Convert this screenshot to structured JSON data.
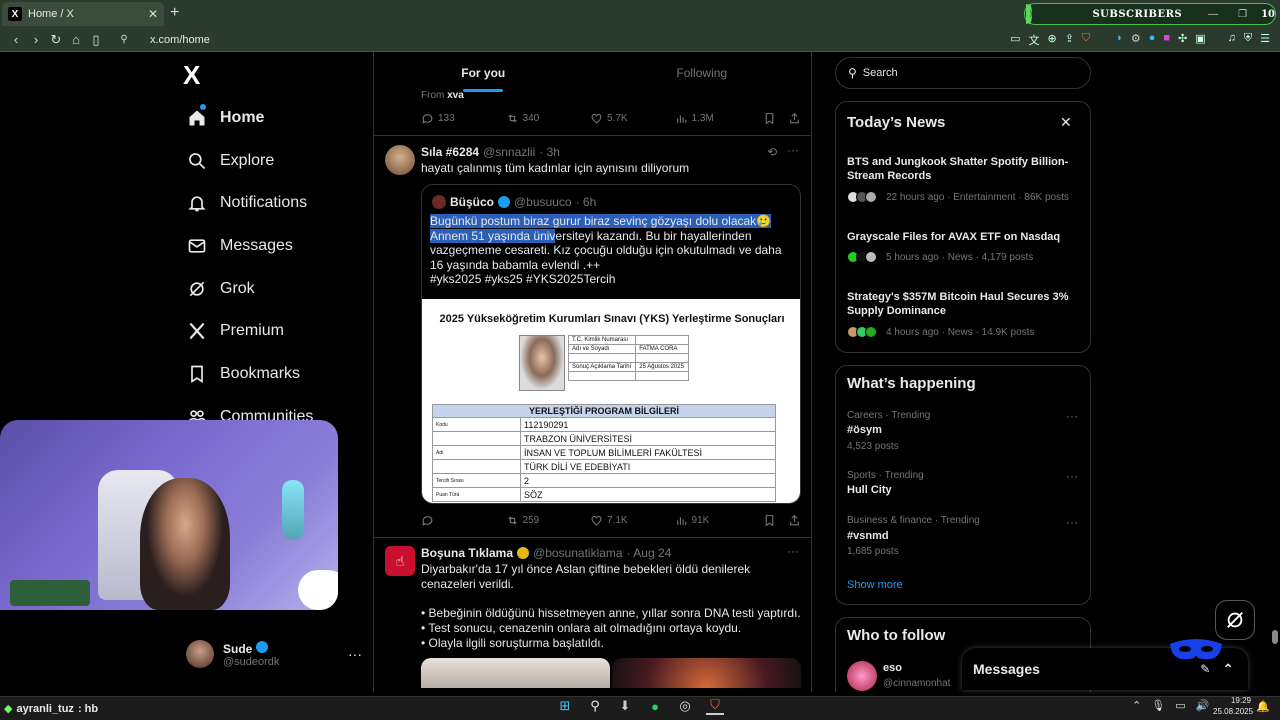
{
  "browser": {
    "tab_title": "Home / X",
    "tab_logo": "X",
    "new_tab": "+",
    "url": "x.com/home",
    "subscribers_label": "SUBSCRIBERS",
    "subscribers_count": "10",
    "subscribers_dot": "0"
  },
  "nav": {
    "logo": "X",
    "items": [
      {
        "label": "Home",
        "icon": "home-icon"
      },
      {
        "label": "Explore",
        "icon": "search-icon"
      },
      {
        "label": "Notifications",
        "icon": "bell-icon"
      },
      {
        "label": "Messages",
        "icon": "mail-icon"
      },
      {
        "label": "Grok",
        "icon": "grok-icon"
      },
      {
        "label": "Premium",
        "icon": "x-icon"
      },
      {
        "label": "Bookmarks",
        "icon": "bookmark-icon"
      },
      {
        "label": "Communities",
        "icon": "people-icon"
      }
    ],
    "profile": {
      "name": "Sude",
      "handle": "@sudeordk",
      "more": "···"
    }
  },
  "feed": {
    "tabs": [
      "For you",
      "Following"
    ],
    "prev_tweet": {
      "from_prefix": "From",
      "from_name": "xva",
      "replies": "133",
      "reposts": "340",
      "likes": "5.7K",
      "views": "1.3M"
    },
    "tweet1": {
      "name": "Sıla #6284",
      "handle": "@snnazlii",
      "time": "· 3h",
      "text": "hayatı çalınmış tüm kadınlar için aynısını diliyorum",
      "quote": {
        "name": "Büşüco",
        "handle": "@busuuco",
        "time": "· 6h",
        "text_highlight": "Bugünkü postum biraz gurur biraz sevinç gözyaşı dolu olacak🥲 Annem 51 yaşında üniv",
        "text_rest": "ersiteyi kazandı. Bu bir hayallerinden vazgeçmeme cesareti. Kız çocuğu olduğu için okutulmadı ve daha 16 yaşında babamla evlendi .++",
        "hashtags": "#yks2025 #yks25 #YKS2025Tercih",
        "doc": {
          "title": "2025 Yükseköğretim Kurumları Sınavı (YKS) Yerleştirme Sonuçları",
          "id_rows": [
            [
              "T.C. Kimlik Numarası",
              ""
            ],
            [
              "Adı ve Soyadı",
              "FATMA CORA"
            ],
            [
              "",
              ""
            ],
            [
              "Sonuç Açıklama Tarihi",
              "25 Ağustos 2025"
            ],
            [
              "",
              ""
            ]
          ],
          "prog_header": "YERLEŞTİĞİ PROGRAM BİLGİLERİ",
          "prog_rows": [
            [
              "Kodu",
              "112190291"
            ],
            [
              "",
              "TRABZON ÜNİVERSİTESİ"
            ],
            [
              "Adı",
              "İNSAN VE TOPLUM BİLİMLERİ FAKÜLTESİ"
            ],
            [
              "",
              "TÜRK DİLİ VE EDEBİYATI"
            ],
            [
              "Tercih Sırası",
              "2"
            ],
            [
              "Puan Türü",
              "SÖZ"
            ]
          ]
        }
      },
      "reposts": "259",
      "likes": "7.1K",
      "views": "91K"
    },
    "tweet2": {
      "name": "Boşuna Tıklama",
      "handle": "@bosunatiklama",
      "time": "· Aug 24",
      "line1": "Diyarbakır'da 17 yıl önce Aslan çiftine bebekleri öldü denilerek cenazeleri verildi.",
      "bullets": [
        "• Bebeğinin öldüğünü hissetmeyen anne, yıllar sonra DNA testi yaptırdı.",
        "• Test sonucu, cenazenin onlara ait olmadığını ortaya koydu.",
        "• Olayla ilgili soruşturma başlatıldı."
      ]
    }
  },
  "sidebar": {
    "search_placeholder": "Search",
    "news": {
      "title": "Today’s News",
      "items": [
        {
          "title": "BTS and Jungkook Shatter Spotify Billion-Stream Records",
          "meta": "22 hours ago · Entertainment · 86K posts"
        },
        {
          "title": "Grayscale Files for AVAX ETF on Nasdaq",
          "meta": "5 hours ago · News · 4,179 posts"
        },
        {
          "title": "Strategy's $357M Bitcoin Haul Secures 3% Supply Dominance",
          "meta": "4 hours ago · News · 14.9K posts"
        }
      ]
    },
    "happening": {
      "title": "What’s happening",
      "items": [
        {
          "cat": "Careers · Trending",
          "name": "#ösym",
          "posts": "4,523 posts"
        },
        {
          "cat": "Sports · Trending",
          "name": "Hull City",
          "posts": ""
        },
        {
          "cat": "Business & finance · Trending",
          "name": "#vsnmd",
          "posts": "1,685 posts"
        }
      ],
      "show_more": "Show more"
    },
    "who_to_follow": {
      "title": "Who to follow",
      "first_name": "eso",
      "first_handle": "@cinnamonhat"
    },
    "messages_dock": "Messages"
  },
  "taskbar": {
    "stream_user": "ayranli_tuz",
    "stream_suffix": ": hb",
    "time": "19:29",
    "date": "25.08.2025"
  }
}
